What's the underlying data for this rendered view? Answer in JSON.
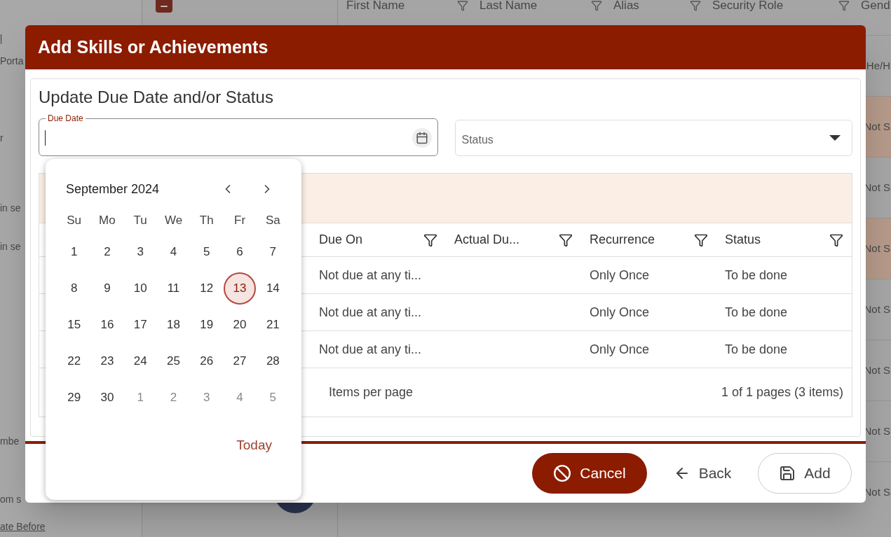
{
  "background": {
    "side_items": [
      {
        "text": "l",
        "kind": "link"
      },
      {
        "text": "Porta",
        "kind": "text"
      },
      {
        "text": "r",
        "kind": "text"
      },
      {
        "text": "in se",
        "kind": "text"
      },
      {
        "text": "in se",
        "kind": "text"
      },
      {
        "text": "mbe",
        "kind": "text"
      },
      {
        "text": "om s",
        "kind": "text"
      },
      {
        "text": "ate Before",
        "kind": "link"
      }
    ],
    "columns": [
      {
        "label": "First Name"
      },
      {
        "label": "Last Name"
      },
      {
        "label": "Alias"
      },
      {
        "label": "Security Role"
      },
      {
        "label": "Gend"
      }
    ],
    "rows": [
      {
        "column_5": "He/H",
        "selected": false
      },
      {
        "column_5": "Not S",
        "selected": true
      },
      {
        "column_5": "Not S",
        "selected": false
      },
      {
        "column_5": "Not S",
        "selected": true
      },
      {
        "column_5": "Not S",
        "selected": false
      },
      {
        "column_5": "Not S",
        "selected": false
      },
      {
        "column_5": "Not S",
        "selected": false
      },
      {
        "column_5": "Not S",
        "selected": false
      }
    ]
  },
  "dialog": {
    "title": "Add Skills or Achievements",
    "section_title": "Update Due Date and/or Status",
    "due_date": {
      "label": "Due Date"
    },
    "status": {
      "placeholder": "Status"
    },
    "grid": {
      "columns": [
        {
          "label": "Due On"
        },
        {
          "label": "Actual Du..."
        },
        {
          "label": "Recurrence"
        },
        {
          "label": "Status"
        }
      ],
      "rows": [
        {
          "due_on": "Not due at any ti...",
          "actual_due": "",
          "recurrence": "Only Once",
          "status": "To be done"
        },
        {
          "due_on": "Not due at any ti...",
          "actual_due": "",
          "recurrence": "Only Once",
          "status": "To be done"
        },
        {
          "due_on": "Not due at any ti...",
          "actual_due": "",
          "recurrence": "Only Once",
          "status": "To be done"
        }
      ],
      "pager": {
        "items_per_page": "Items per page",
        "summary": "1 of 1 pages (3 items)"
      }
    },
    "buttons": [
      {
        "label": "Cancel",
        "kind": "cancel"
      },
      {
        "label": "Back",
        "kind": "back"
      },
      {
        "label": "Add",
        "kind": "add"
      }
    ]
  },
  "calendar": {
    "title": "September 2024",
    "weekdays": [
      "Su",
      "Mo",
      "Tu",
      "We",
      "Th",
      "Fr",
      "Sa"
    ],
    "weeks": [
      [
        {
          "label": "1",
          "outside": false,
          "selected": false
        },
        {
          "label": "2",
          "outside": false,
          "selected": false
        },
        {
          "label": "3",
          "outside": false,
          "selected": false
        },
        {
          "label": "4",
          "outside": false,
          "selected": false
        },
        {
          "label": "5",
          "outside": false,
          "selected": false
        },
        {
          "label": "6",
          "outside": false,
          "selected": false
        },
        {
          "label": "7",
          "outside": false,
          "selected": false
        }
      ],
      [
        {
          "label": "8",
          "outside": false,
          "selected": false
        },
        {
          "label": "9",
          "outside": false,
          "selected": false
        },
        {
          "label": "10",
          "outside": false,
          "selected": false
        },
        {
          "label": "11",
          "outside": false,
          "selected": false
        },
        {
          "label": "12",
          "outside": false,
          "selected": false
        },
        {
          "label": "13",
          "outside": false,
          "selected": true
        },
        {
          "label": "14",
          "outside": false,
          "selected": false
        }
      ],
      [
        {
          "label": "15",
          "outside": false,
          "selected": false
        },
        {
          "label": "16",
          "outside": false,
          "selected": false
        },
        {
          "label": "17",
          "outside": false,
          "selected": false
        },
        {
          "label": "18",
          "outside": false,
          "selected": false
        },
        {
          "label": "19",
          "outside": false,
          "selected": false
        },
        {
          "label": "20",
          "outside": false,
          "selected": false
        },
        {
          "label": "21",
          "outside": false,
          "selected": false
        }
      ],
      [
        {
          "label": "22",
          "outside": false,
          "selected": false
        },
        {
          "label": "23",
          "outside": false,
          "selected": false
        },
        {
          "label": "24",
          "outside": false,
          "selected": false
        },
        {
          "label": "25",
          "outside": false,
          "selected": false
        },
        {
          "label": "26",
          "outside": false,
          "selected": false
        },
        {
          "label": "27",
          "outside": false,
          "selected": false
        },
        {
          "label": "28",
          "outside": false,
          "selected": false
        }
      ],
      [
        {
          "label": "29",
          "outside": false,
          "selected": false
        },
        {
          "label": "30",
          "outside": false,
          "selected": false
        },
        {
          "label": "1",
          "outside": true,
          "selected": false
        },
        {
          "label": "2",
          "outside": true,
          "selected": false
        },
        {
          "label": "3",
          "outside": true,
          "selected": false
        },
        {
          "label": "4",
          "outside": true,
          "selected": false
        },
        {
          "label": "5",
          "outside": true,
          "selected": false
        }
      ]
    ],
    "today": "Today"
  }
}
